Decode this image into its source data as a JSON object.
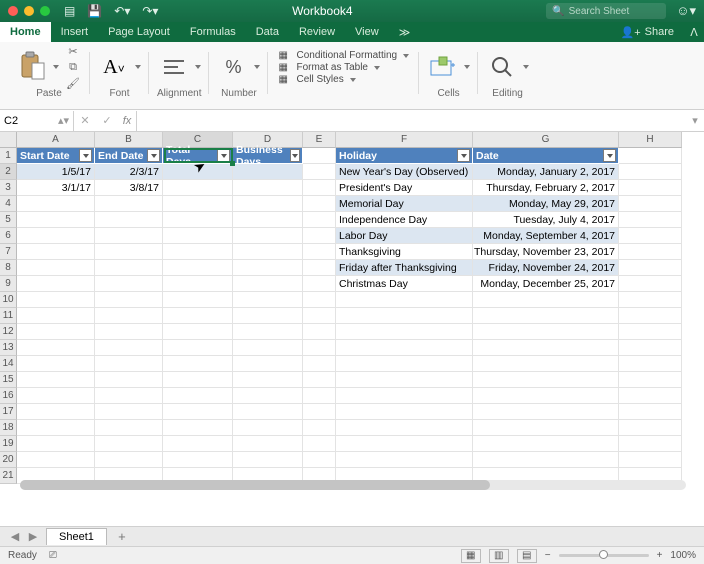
{
  "title": "Workbook4",
  "search_placeholder": "Search Sheet",
  "menu": {
    "home": "Home",
    "insert": "Insert",
    "page_layout": "Page Layout",
    "formulas": "Formulas",
    "data": "Data",
    "review": "Review",
    "view": "View",
    "share": "Share"
  },
  "ribbon": {
    "paste": "Paste",
    "font": "Font",
    "alignment": "Alignment",
    "number": "Number",
    "cond_fmt": "Conditional Formatting",
    "fmt_table": "Format as Table",
    "cell_styles": "Cell Styles",
    "cells": "Cells",
    "editing": "Editing"
  },
  "namebox": "C2",
  "columns": [
    "A",
    "B",
    "C",
    "D",
    "E",
    "F",
    "G",
    "H"
  ],
  "table1_headers": {
    "a": "Start Date",
    "b": "End Date",
    "c": "Total Days",
    "d": "Business Days"
  },
  "table2_headers": {
    "f": "Holiday",
    "g": "Date"
  },
  "table1_rows": [
    {
      "a": "1/5/17",
      "b": "2/3/17",
      "c": "",
      "d": ""
    },
    {
      "a": "3/1/17",
      "b": "3/8/17",
      "c": "",
      "d": ""
    }
  ],
  "table2_rows": [
    {
      "f": "New Year's Day (Observed)",
      "g": "Monday, January 2, 2017"
    },
    {
      "f": "President's Day",
      "g": "Thursday, February 2, 2017"
    },
    {
      "f": "Memorial Day",
      "g": "Monday, May 29, 2017"
    },
    {
      "f": "Independence Day",
      "g": "Tuesday, July 4, 2017"
    },
    {
      "f": "Labor Day",
      "g": "Monday, September 4, 2017"
    },
    {
      "f": "Thanksgiving",
      "g": "Thursday, November 23, 2017"
    },
    {
      "f": "Friday after Thanksgiving",
      "g": "Friday, November 24, 2017"
    },
    {
      "f": "Christmas Day",
      "g": "Monday, December 25, 2017"
    }
  ],
  "sheet_tab": "Sheet1",
  "status": "Ready",
  "zoom": "100%"
}
